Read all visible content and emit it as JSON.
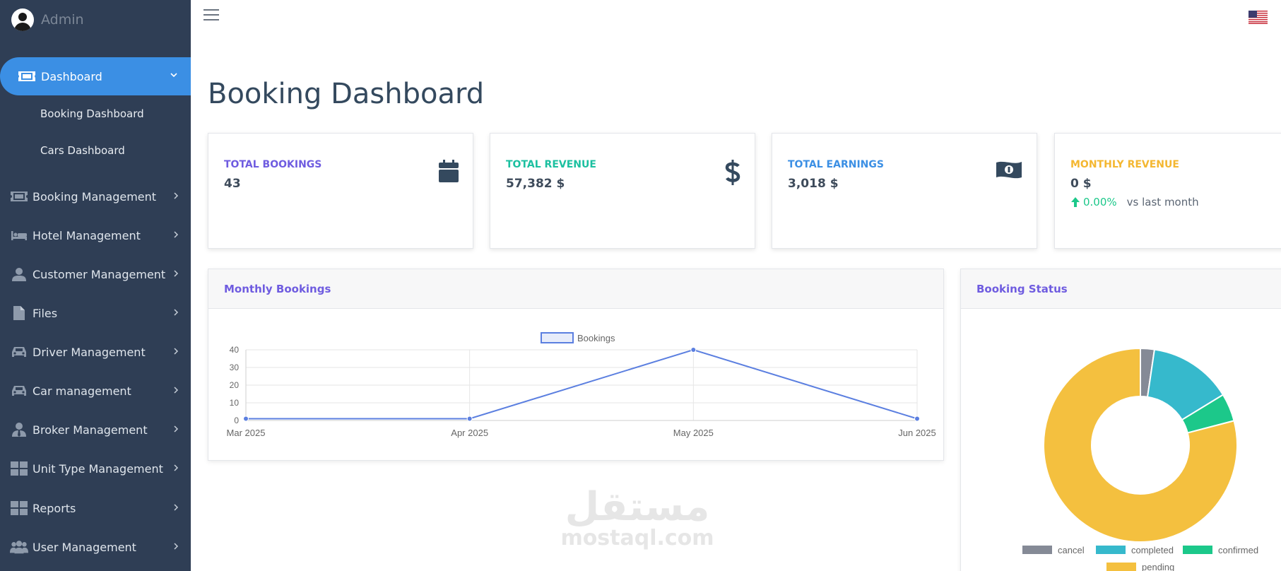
{
  "brand": {
    "name": "Admin"
  },
  "sidebar": {
    "active": {
      "label": "Dashboard"
    },
    "sub_items": [
      {
        "label": "Booking Dashboard"
      },
      {
        "label": "Cars Dashboard"
      }
    ],
    "items": [
      {
        "label": "Booking Management",
        "icon": "ticket-icon"
      },
      {
        "label": "Hotel Management",
        "icon": "bed-icon"
      },
      {
        "label": "Customer Management",
        "icon": "user-icon"
      },
      {
        "label": "Files",
        "icon": "file-icon"
      },
      {
        "label": "Driver Management",
        "icon": "car-icon"
      },
      {
        "label": "Car management",
        "icon": "car-icon"
      },
      {
        "label": "Broker Management",
        "icon": "user-tie-icon"
      },
      {
        "label": "Unit Type Management",
        "icon": "grid-icon"
      },
      {
        "label": "Reports",
        "icon": "grid-icon"
      },
      {
        "label": "User Management",
        "icon": "users-icon"
      }
    ]
  },
  "page": {
    "title": "Booking Dashboard"
  },
  "cards": [
    {
      "label": "TOTAL BOOKINGS",
      "value": "43",
      "color": "#6f5ce0",
      "icon": "calendar-icon"
    },
    {
      "label": "TOTAL REVENUE",
      "value": "57,382 $",
      "color": "#1cc0a0",
      "icon": "dollar-icon"
    },
    {
      "label": "TOTAL EARNINGS",
      "value": "3,018 $",
      "color": "#3b8fe4",
      "icon": "money-bill-icon"
    },
    {
      "label": "MONTHLY REVENUE",
      "value": "0 $",
      "color": "#f4b731",
      "icon": "",
      "trend": {
        "percent": "0.00%",
        "text": "vs last month"
      }
    }
  ],
  "panels": {
    "monthly": {
      "title": "Monthly Bookings"
    },
    "status": {
      "title": "Booking Status"
    }
  },
  "watermark": {
    "arabic": "مستقل",
    "latin": "mostaql.com"
  },
  "chart_data": [
    {
      "type": "line",
      "x": [
        "Mar 2025",
        "Apr 2025",
        "May 2025",
        "Jun 2025"
      ],
      "series": [
        {
          "name": "Bookings",
          "values": [
            1,
            1,
            40,
            1
          ],
          "color": "#5b7fe0"
        }
      ],
      "ylim": [
        0,
        40
      ],
      "yticks": [
        0,
        10,
        20,
        30,
        40
      ],
      "grid": true,
      "legend": "top-center"
    },
    {
      "type": "pie",
      "donut": true,
      "labels": [
        "cancel",
        "completed",
        "confirmed",
        "pending"
      ],
      "values": [
        1,
        6,
        2,
        34
      ],
      "colors": [
        "#858a96",
        "#36b9cc",
        "#1cc88a",
        "#f4c03f"
      ],
      "legend": "bottom"
    }
  ]
}
